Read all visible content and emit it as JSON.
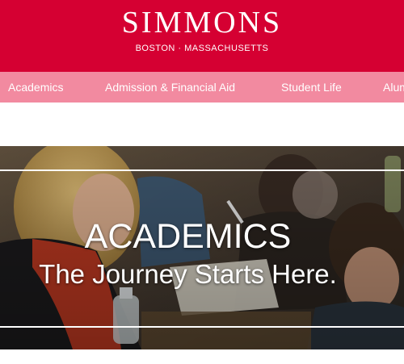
{
  "header": {
    "logo": "SIMMONS",
    "tagline": "BOSTON · MASSACHUSETTS",
    "background_color": "#d50032"
  },
  "nav": {
    "background_color": "#f28aa0",
    "items": [
      {
        "label": "Academics"
      },
      {
        "label": "Admission & Financial Aid"
      },
      {
        "label": "Student Life"
      },
      {
        "label": "Alum"
      }
    ]
  },
  "hero": {
    "title": "ACADEMICS",
    "subtitle": "The Journey Starts Here."
  }
}
